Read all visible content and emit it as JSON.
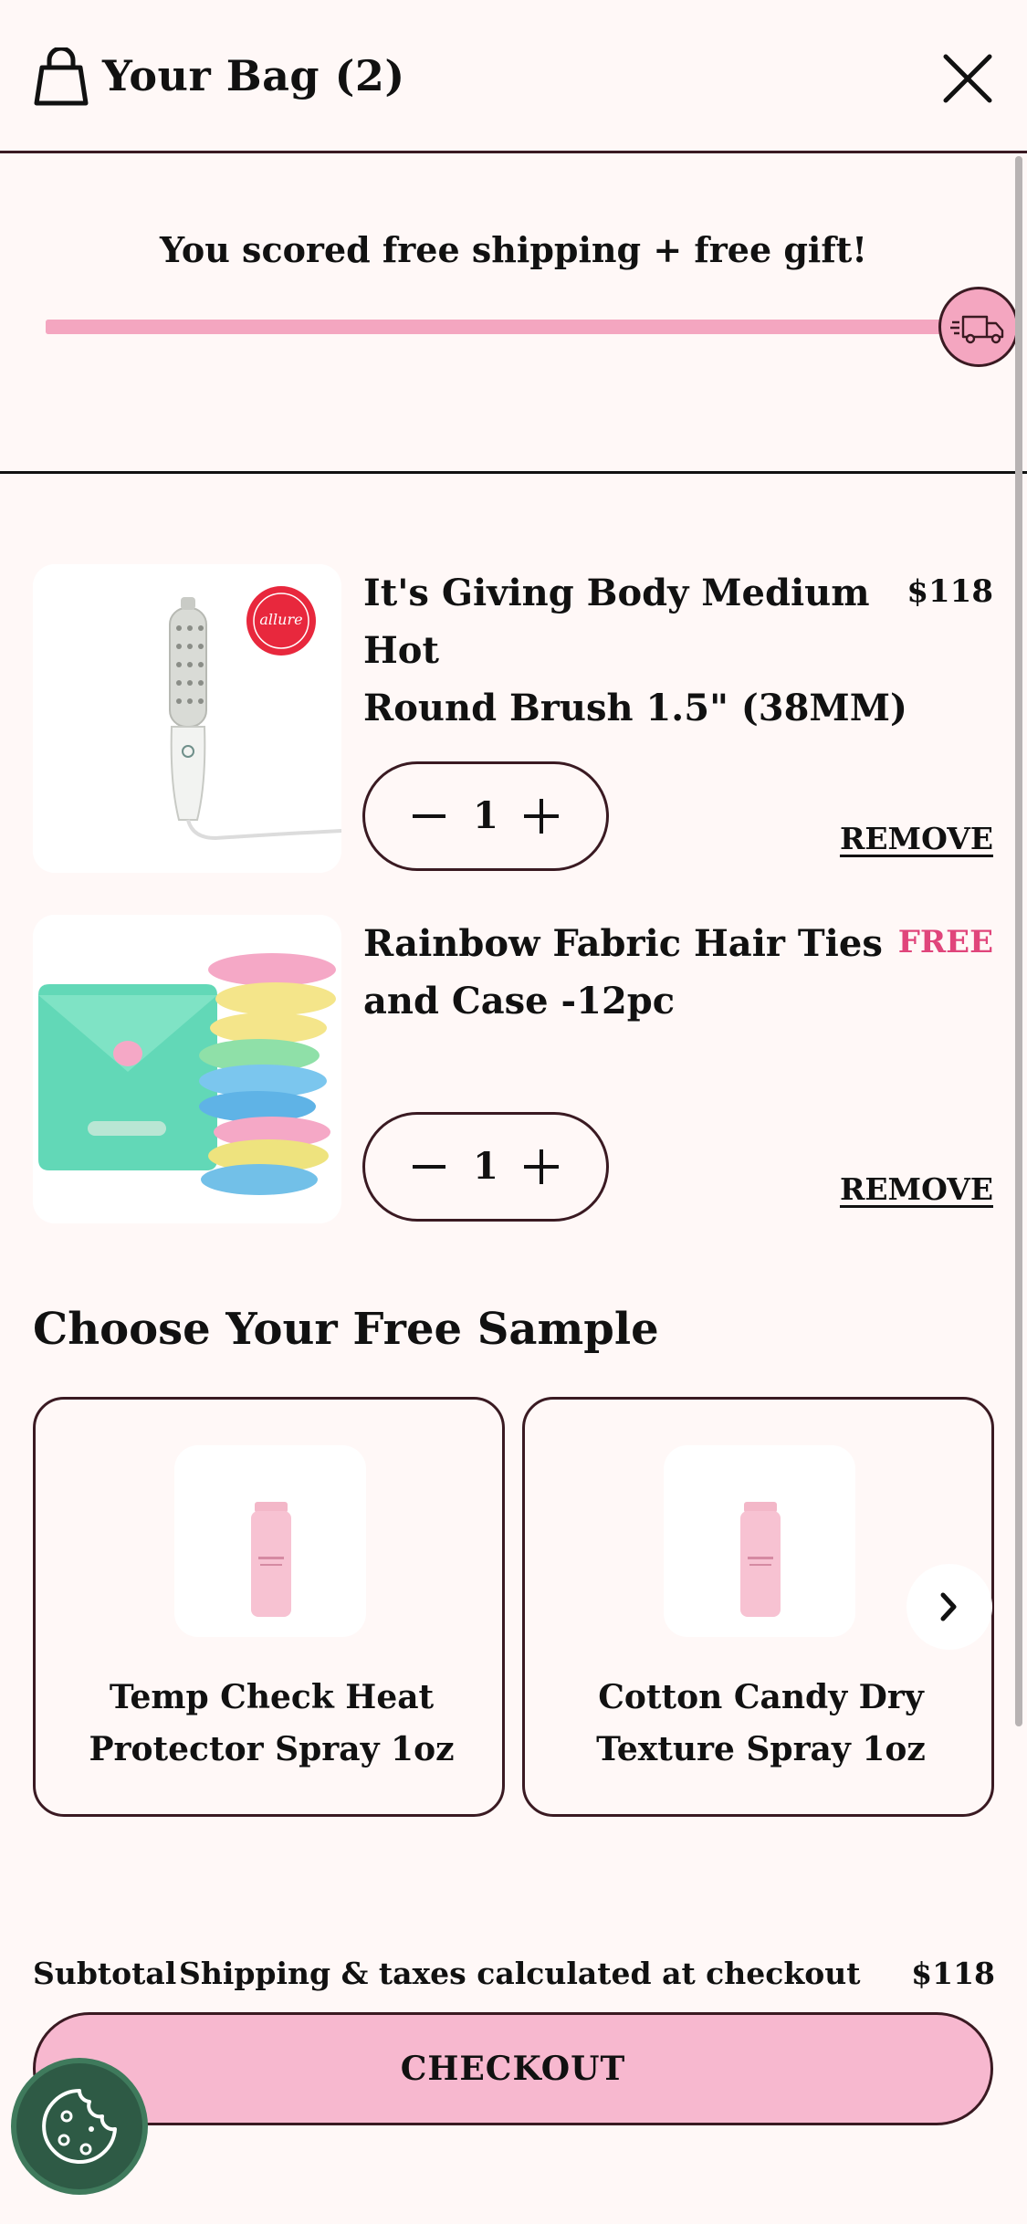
{
  "header": {
    "title": "Your Bag (2)",
    "bag_icon": "shopping-bag-icon",
    "close_icon": "close-icon"
  },
  "shipping_banner": {
    "message": "You scored free shipping + free gift!",
    "progress_fraction": 1.0,
    "truck_icon": "delivery-truck-icon"
  },
  "cart": {
    "items": [
      {
        "name_line1": "It's Giving Body Medium Hot",
        "name_line2": "Round Brush 1.5\" (38MM)",
        "price": "$118",
        "quantity": "1",
        "remove_label": "REMOVE",
        "badge_text": "allure"
      },
      {
        "name_line1": "Rainbow Fabric Hair Ties",
        "name_line2": "and Case -12pc",
        "price": "FREE",
        "quantity": "1",
        "remove_label": "REMOVE"
      }
    ]
  },
  "samples": {
    "title": "Choose Your Free Sample",
    "items": [
      {
        "line1": "Temp Check Heat",
        "line2": "Protector Spray 1oz"
      },
      {
        "line1": "Cotton Candy Dry",
        "line2": "Texture Spray 1oz"
      }
    ],
    "next_icon": "chevron-right-icon"
  },
  "footer": {
    "subtotal_label": "Subtotal",
    "shipping_note": "Shipping & taxes calculated at checkout",
    "subtotal_amount": "$118",
    "checkout_label": "CHECKOUT",
    "cookie_icon": "cookie-icon"
  },
  "colors": {
    "background": "#fff8f7",
    "accent_pink": "#f4a6c0",
    "checkout_pink": "#f7b8cf",
    "free_text": "#e0457b",
    "border_dark": "#3a1a22",
    "cookie_green": "#2e5a45"
  }
}
